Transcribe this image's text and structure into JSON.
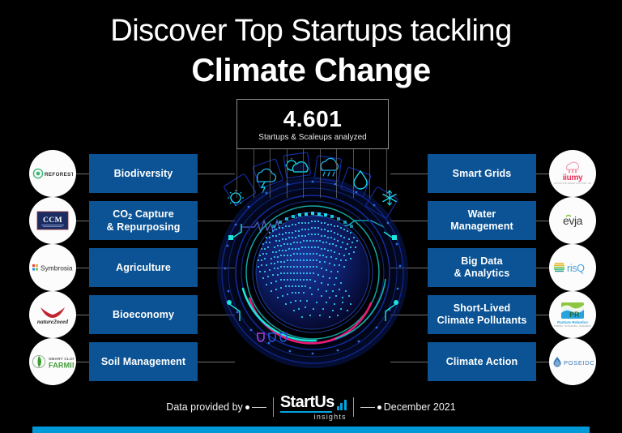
{
  "header": {
    "title_line1": "Discover Top Startups tackling",
    "title_line2": "Climate Change"
  },
  "stat": {
    "value": "4.601",
    "caption": "Startups & Scaleups analyzed"
  },
  "center_graphic": {
    "name": "digital-globe-dashboard",
    "weather_icons": [
      "sun-icon",
      "storm-icon",
      "partly-cloudy-icon",
      "rain-cloud-icon",
      "water-drop-icon",
      "snowflake-icon"
    ],
    "colors": {
      "globe_dots": "#29b6f6",
      "accent_cyan": "#18e6d8",
      "accent_pink": "#ec1a78",
      "ring_blue": "#1f3fd6"
    }
  },
  "left_categories": [
    {
      "label": "Biodiversity",
      "logo_name": "reforestum-logo",
      "logo_text": "REFORESTUM"
    },
    {
      "label": "CO2 Capture & Repurposing",
      "label_pre": "CO",
      "label_sub": "2",
      "label_post": " Capture",
      "label_line2": "& Repurposing",
      "logo_name": "ccm-logo",
      "logo_text": "CCM"
    },
    {
      "label": "Agriculture",
      "logo_name": "symbrosia-logo",
      "logo_text": "Symbrosia"
    },
    {
      "label": "Bioeconomy",
      "logo_name": "nature2need-logo",
      "logo_text": "nature2need"
    },
    {
      "label": "Soil Management",
      "logo_name": "smart-cloud-farming-logo",
      "logo_text": "FARMING",
      "logo_text_top": "SMART CLOUD"
    }
  ],
  "right_categories": [
    {
      "label": "Smart Grids",
      "logo_name": "iiumy-logo",
      "logo_text": "iiumy"
    },
    {
      "label": "Water Management",
      "label_line1": "Water",
      "label_line2": "Management",
      "logo_name": "evja-logo",
      "logo_text": "evja"
    },
    {
      "label": "Big Data & Analytics",
      "label_line1": "Big Data",
      "label_line2": "& Analytics",
      "logo_name": "risq-logo",
      "logo_text": "risQ"
    },
    {
      "label": "Short-Lived Climate Pollutants",
      "label_line1": "Short-Lived",
      "label_line2": "Climate Pollutants",
      "logo_name": "pasture-robotics-logo",
      "logo_text": "Pasture Robotics"
    },
    {
      "label": "Climate Action",
      "logo_name": "poseidon-logo",
      "logo_text": "POSEIDON"
    }
  ],
  "footer": {
    "provided_by": "Data provided by",
    "brand_main": "StartUs",
    "brand_sub": "insights",
    "date": "December 2021"
  },
  "colors": {
    "background": "#000000",
    "category_blue": "#0b5394",
    "accent_bar": "#0099d8",
    "connector": "#707070"
  }
}
